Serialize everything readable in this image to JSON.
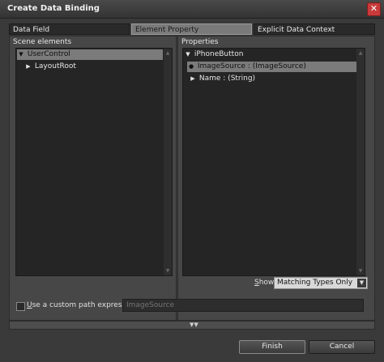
{
  "window": {
    "title": "Create Data Binding",
    "close_glyph": "✕"
  },
  "tabs": [
    {
      "label": "Data Field"
    },
    {
      "label": "Element Property"
    },
    {
      "label": "Explicit Data Context"
    }
  ],
  "scene": {
    "label": "Scene elements",
    "items": [
      {
        "label": "UserControl",
        "expander": "▼"
      },
      {
        "label": "LayoutRoot",
        "expander": "▶"
      }
    ]
  },
  "properties": {
    "label": "Properties",
    "items": [
      {
        "label": "iPhoneButton",
        "expander": "▼"
      },
      {
        "label": "ImageSource : (ImageSource)",
        "expander": "●"
      },
      {
        "label": "Name : (String)",
        "expander": "▶"
      }
    ]
  },
  "show": {
    "label_underline": "S",
    "label_rest": "how",
    "selected": "Matching Types Only",
    "dropdown_glyph": "▼"
  },
  "custom_path": {
    "label_underline": "U",
    "label_rest": "se a custom path expression",
    "checked": false,
    "placeholder": "ImageSource"
  },
  "expander": {
    "glyph": "▼▼"
  },
  "buttons": {
    "finish": "Finish",
    "cancel": "Cancel"
  }
}
